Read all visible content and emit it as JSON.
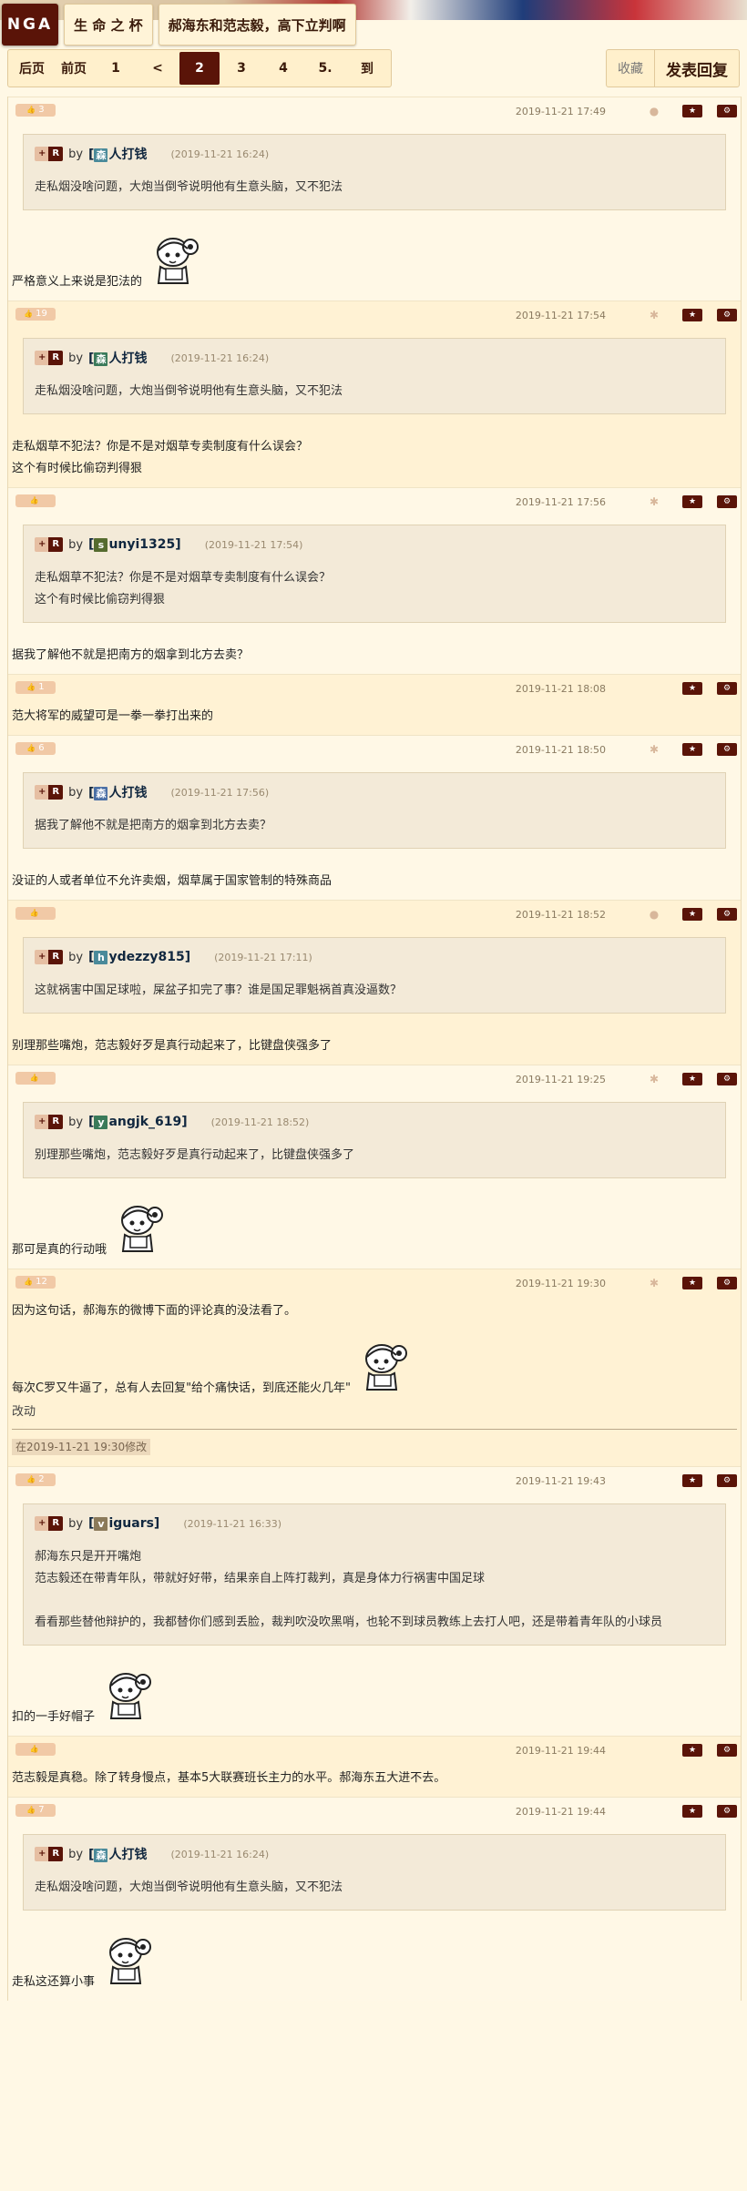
{
  "header": {
    "logo": "NGA",
    "crumbs": [
      "生 命 之 杯",
      "郝海东和范志毅，高下立判啊"
    ]
  },
  "pager": {
    "items": [
      "后页",
      "前页",
      "1",
      "<",
      "2",
      "3",
      "4",
      "5.",
      "到"
    ],
    "current": "2"
  },
  "actions": {
    "favorite": "收藏",
    "reply": "发表回复"
  },
  "icons": {
    "thumb": "thumb-up-icon",
    "star": "star-icon",
    "gear": "gear-icon",
    "device": "device-icon"
  },
  "quote_prefix": "by",
  "posts": [
    {
      "votes": "3",
      "date": "2019-11-21 17:49",
      "device": "apple",
      "quote": {
        "user_initial": "森",
        "user_rest": "人打钱",
        "time": "(2019-11-21 16:24)",
        "lines": [
          "走私烟没啥问题，大炮当倒爷说明他有生意头脑，又不犯法"
        ]
      },
      "lines": [
        "严格意义上来说是犯法的"
      ],
      "sticker_after": 0
    },
    {
      "votes": "19",
      "date": "2019-11-21 17:54",
      "device": "android",
      "quote": {
        "user_initial": "森",
        "user_rest": "人打钱",
        "time": "(2019-11-21 16:24)",
        "lines": [
          "走私烟没啥问题，大炮当倒爷说明他有生意头脑，又不犯法"
        ]
      },
      "lines": [
        "走私烟草不犯法？你是不是对烟草专卖制度有什么误会？",
        "这个有时候比偷窃判得狠"
      ]
    },
    {
      "votes": "",
      "date": "2019-11-21 17:56",
      "device": "android",
      "quote": {
        "user_initial": "s",
        "user_rest": "unyi1325]",
        "time": "(2019-11-21 17:54)",
        "lines": [
          "走私烟草不犯法？你是不是对烟草专卖制度有什么误会？",
          "这个有时候比偷窃判得狠"
        ]
      },
      "lines": [
        "据我了解他不就是把南方的烟拿到北方去卖？"
      ]
    },
    {
      "votes": "1",
      "date": "2019-11-21 18:08",
      "device": "",
      "lines": [
        "范大将军的威望可是一拳一拳打出来的"
      ]
    },
    {
      "votes": "6",
      "date": "2019-11-21 18:50",
      "device": "android",
      "quote": {
        "user_initial": "森",
        "user_rest": "人打钱",
        "time": "(2019-11-21 17:56)",
        "lines": [
          "据我了解他不就是把南方的烟拿到北方去卖？"
        ]
      },
      "lines": [
        "没证的人或者单位不允许卖烟，烟草属于国家管制的特殊商品"
      ]
    },
    {
      "votes": "",
      "date": "2019-11-21 18:52",
      "device": "apple",
      "quote": {
        "user_initial": "h",
        "user_rest": "ydezzy815]",
        "time": "(2019-11-21 17:11)",
        "lines": [
          "这就祸害中国足球啦，屎盆子扣完了事？谁是国足罪魁祸首真没逼数？"
        ]
      },
      "lines": [
        "别理那些嘴炮，范志毅好歹是真行动起来了，比键盘侠强多了"
      ]
    },
    {
      "votes": "",
      "date": "2019-11-21 19:25",
      "device": "android",
      "quote": {
        "user_initial": "y",
        "user_rest": "angjk_619]",
        "time": "(2019-11-21 18:52)",
        "lines": [
          "别理那些嘴炮，范志毅好歹是真行动起来了，比键盘侠强多了"
        ]
      },
      "lines": [
        "那可是真的行动哦"
      ]
    },
    {
      "votes": "12",
      "date": "2019-11-21 19:30",
      "device": "android",
      "lines": [
        "因为这句话，郝海东的微博下面的评论真的没法看了。",
        "每次C罗又牛逼了，总有人去回复\"给个痛快话，到底还能火几年\""
      ],
      "change_title": "改动",
      "edit_note": "在2019-11-21 19:30修改"
    },
    {
      "votes": "2",
      "date": "2019-11-21 19:43",
      "device": "",
      "quote": {
        "user_initial": "v",
        "user_rest": "iguars]",
        "time": "(2019-11-21 16:33)",
        "lines": [
          "郝海东只是开开嘴炮",
          "范志毅还在带青年队，带就好好带，结果亲自上阵打裁判，真是身体力行祸害中国足球",
          "",
          "看看那些替他辩护的，我都替你们感到丢脸，裁判吹没吹黑哨，也轮不到球员教练上去打人吧，还是带着青年队的小球员"
        ]
      },
      "lines": [
        "扣的一手好帽子"
      ]
    },
    {
      "votes": "",
      "date": "2019-11-21 19:44",
      "device": "",
      "lines": [
        "范志毅是真稳。除了转身慢点，基本5大联赛班长主力的水平。郝海东五大进不去。"
      ]
    },
    {
      "votes": "7",
      "date": "2019-11-21 19:44",
      "device": "",
      "quote": {
        "user_initial": "森",
        "user_rest": "人打钱",
        "time": "(2019-11-21 16:24)",
        "lines": [
          "走私烟没啥问题，大炮当倒爷说明他有生意头脑，又不犯法"
        ]
      },
      "lines": [
        "走私这还算小事"
      ]
    }
  ],
  "colors": {
    "accent": "#5a1408",
    "bg": "#fff8e5",
    "quote_bg": "#f3ead8"
  }
}
